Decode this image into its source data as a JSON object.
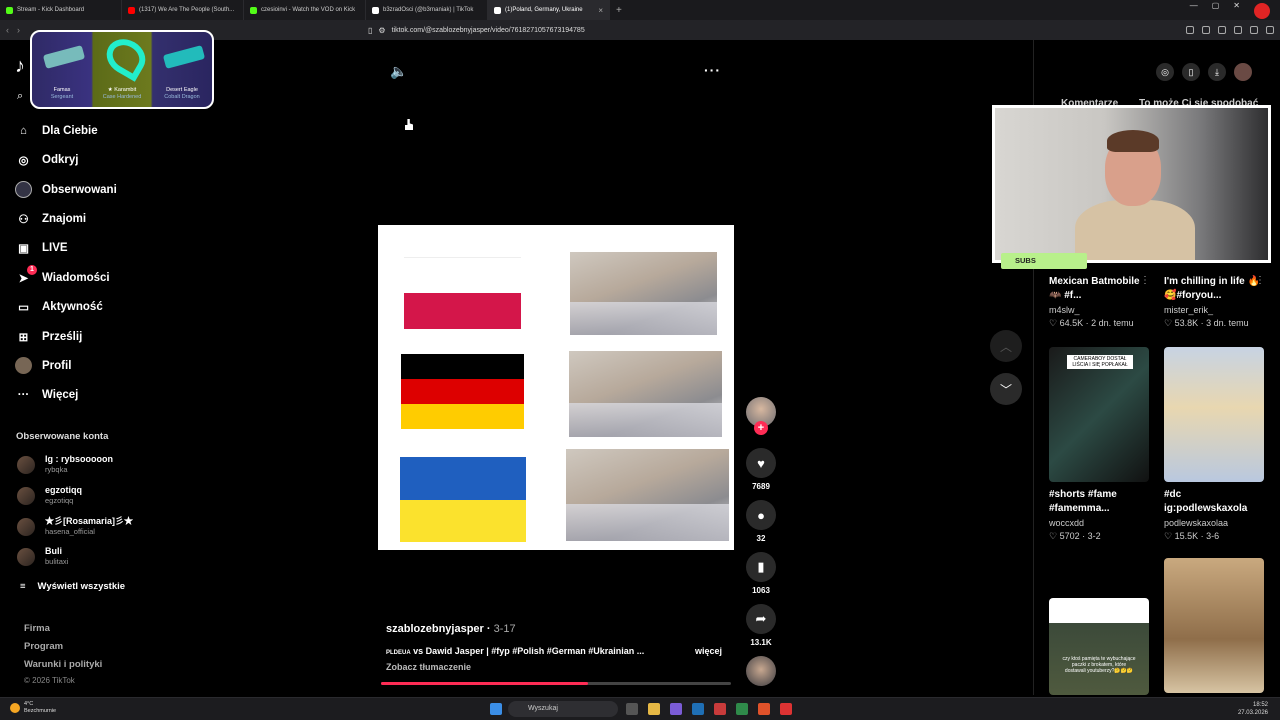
{
  "browser": {
    "tabs": [
      {
        "label": "Stream - Kick Dashboard",
        "color": "#53fc18",
        "active": false
      },
      {
        "label": "(1317) We Are The People (South...",
        "color": "#ff0000",
        "active": false
      },
      {
        "label": "czesioinvi - Watch the VOD on Kick",
        "color": "#53fc18",
        "active": false
      },
      {
        "label": "b3zradOsci (@b3rnaniak) | TikTok",
        "color": "#ffffff",
        "active": false
      },
      {
        "label": "(1)Poland, Germany, Ukraine",
        "color": "#ffffff",
        "active": true
      }
    ],
    "url": "tiktok.com/@szablozebnyjasper/video/7618271057673194785"
  },
  "sidebar": {
    "logo": "tiktok",
    "nav": [
      {
        "label": "Dla Ciebie",
        "icon": "home-icon"
      },
      {
        "label": "Odkryj",
        "icon": "compass-icon"
      },
      {
        "label": "Obserwowani",
        "icon": "following-avatar-icon"
      },
      {
        "label": "Znajomi",
        "icon": "friends-icon"
      },
      {
        "label": "LIVE",
        "icon": "live-icon"
      },
      {
        "label": "Wiadomości",
        "icon": "messages-icon",
        "badge": "1"
      },
      {
        "label": "Aktywność",
        "icon": "activity-icon"
      },
      {
        "label": "Prześlij",
        "icon": "upload-icon"
      },
      {
        "label": "Profil",
        "icon": "profile-icon"
      },
      {
        "label": "Więcej",
        "icon": "more-icon"
      }
    ],
    "followed_title": "Obserwowane konta",
    "followed": [
      {
        "name": "Ig : rybsooooon",
        "handle": "rybqka"
      },
      {
        "name": "egzotiqq",
        "handle": "egzotiqq"
      },
      {
        "name": "★彡[Rosamaria]彡★",
        "handle": "hasena_official"
      },
      {
        "name": "Buli",
        "handle": "bulitaxi"
      }
    ],
    "show_all": "Wyświetl wszystkie",
    "footer": [
      "Firma",
      "Program",
      "Warunki i polityki"
    ],
    "copyright": "© 2026 TikTok"
  },
  "case_overlay": {
    "items": [
      {
        "name": "Famas",
        "sub": "Sergeant"
      },
      {
        "name": "★ Karambit",
        "sub": "Case Hardened"
      },
      {
        "name": "Desert Eagle",
        "sub": "Cobalt Dragon"
      }
    ]
  },
  "video": {
    "author": "szablozebnyjasper",
    "date": "3-17",
    "caption_prefix": "PLDEUA",
    "caption": " vs Dawid Jasper | #fyp #Polish #German #Ukrainian ...",
    "more": "więcej",
    "translate": "Zobacz tłumaczenie",
    "progress": 0.59,
    "likes": "7689",
    "comments": "32",
    "saves": "1063",
    "shares": "13.1K",
    "flag_colors": {
      "poland": [
        "#ffffff",
        "#d4164a"
      ],
      "germany": [
        "#000000",
        "#dd0000",
        "#ffcc00"
      ],
      "ukraine": [
        "#0057b7",
        "#ffd700"
      ]
    }
  },
  "right_panel": {
    "tabs": [
      "Komentarze",
      "To może Ci się spodobać"
    ],
    "cards": [
      {
        "title": "Mexican Batmobile 🦇 #f...",
        "user": "m4slw_",
        "views": "64.5K",
        "date": "2 dn. temu"
      },
      {
        "title": "I'm chilling in life 🔥🥰#foryou...",
        "user": "mister_erik_",
        "views": "53.8K",
        "date": "3 dn. temu"
      },
      {
        "title": "#shorts #fame #famemma...",
        "user": "woccxdd",
        "views": "5702",
        "date": "3-2"
      },
      {
        "title": "#dc ig:podlewskaxola",
        "user": "podlewskaxolaa",
        "views": "15.5K",
        "date": "3-6"
      }
    ],
    "thumb_text": {
      "card3": "CAMERABOY DOSTAŁ LIŚCIA I SIĘ POPŁAKAŁ",
      "card5": "czy ktoś pamięta te wybuchające paczki z brokatem, które dostawali youtuberzy?🤔🤔🤔"
    },
    "webcam_tag": "SUBS"
  },
  "taskbar": {
    "weather_temp": "4°C",
    "weather_desc": "Bezchmurnie",
    "search": "Wyszukaj",
    "time": "18:52",
    "date": "27.03.2026"
  }
}
